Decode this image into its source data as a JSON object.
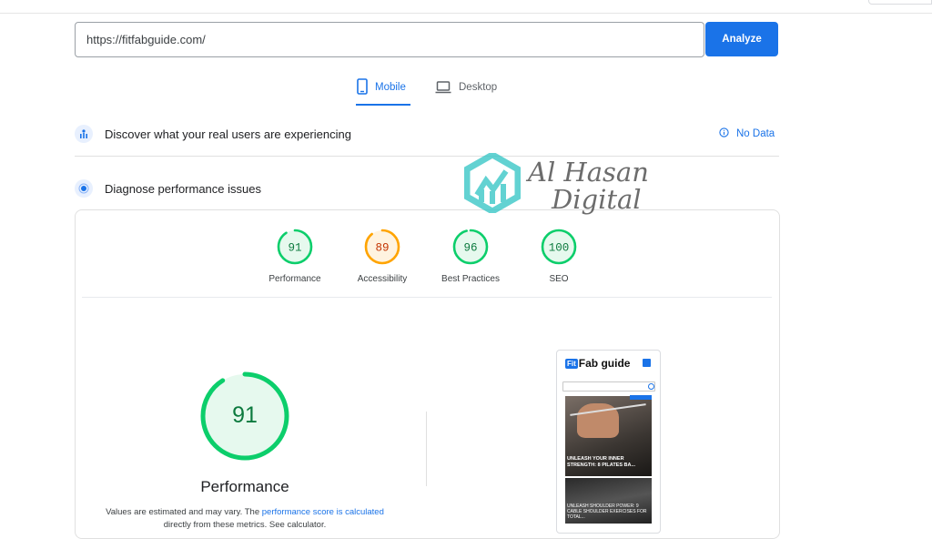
{
  "search": {
    "url": "https://fitfabguide.com/",
    "button_label": "Analyze"
  },
  "tabs": [
    {
      "label": "Mobile",
      "icon": "smartphone-icon",
      "active": true
    },
    {
      "label": "Desktop",
      "icon": "laptop-icon",
      "active": false
    }
  ],
  "field_data": {
    "title": "Discover what your real users are experiencing",
    "status": "No Data"
  },
  "lab_data": {
    "title": "Diagnose performance issues"
  },
  "scores": [
    {
      "label": "Performance",
      "value": "91",
      "color": "#0cce6b"
    },
    {
      "label": "Accessibility",
      "value": "89",
      "color": "#ffa400"
    },
    {
      "label": "Best Practices",
      "value": "96",
      "color": "#0cce6b"
    },
    {
      "label": "SEO",
      "value": "100",
      "color": "#0cce6b"
    }
  ],
  "main_score": {
    "value": "91",
    "label": "Performance",
    "note_prefix": "Values are estimated and may vary. The",
    "note_link": "performance score is calculated",
    "note_suffix": "directly from these metrics. See calculator."
  },
  "screenshot": {
    "logo_fit": "Fit",
    "logo_rest": "Fab guide",
    "caption1": "UNLEASH YOUR INNER STRENGTH: 8 PILATES BA...",
    "caption2": "UNLEASH SHOULDER POWER: 9 CABLE SHOULDER EXERCISES FOR TOTAL..."
  },
  "watermark": {
    "line1": "Al Hasan",
    "line2": "Digital"
  },
  "colors": {
    "accent": "#1a73e8",
    "pass": "#0cce6b",
    "average": "#ffa400"
  }
}
